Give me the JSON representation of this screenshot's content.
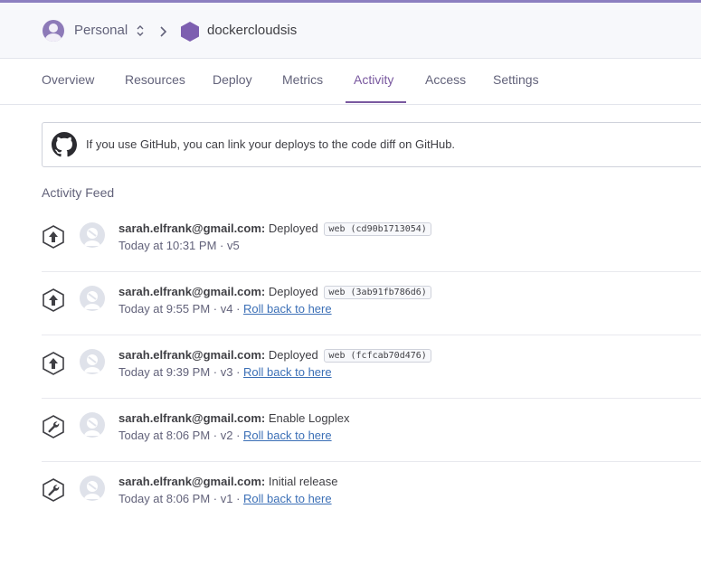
{
  "header": {
    "account": "Personal",
    "app_name": "dockercloudsis"
  },
  "tabs": [
    {
      "label": "Overview",
      "active": false
    },
    {
      "label": "Resources",
      "active": false
    },
    {
      "label": "Deploy",
      "active": false
    },
    {
      "label": "Metrics",
      "active": false
    },
    {
      "label": "Activity",
      "active": true
    },
    {
      "label": "Access",
      "active": false
    },
    {
      "label": "Settings",
      "active": false
    }
  ],
  "banner": {
    "text": "If you use GitHub, you can link your deploys to the code diff on GitHub.",
    "icon": "github-icon"
  },
  "feed": {
    "title": "Activity Feed",
    "items": [
      {
        "icon": "deploy-icon",
        "user": "sarah.elfrank@gmail.com:",
        "action": "Deployed",
        "code": "web (cd90b1713054)",
        "time": "Today at 10:31 PM",
        "version": "v5",
        "rollback": ""
      },
      {
        "icon": "deploy-icon",
        "user": "sarah.elfrank@gmail.com:",
        "action": "Deployed",
        "code": "web (3ab91fb786d6)",
        "time": "Today at 9:55 PM",
        "version": "v4",
        "rollback": "Roll back to here"
      },
      {
        "icon": "deploy-icon",
        "user": "sarah.elfrank@gmail.com:",
        "action": "Deployed",
        "code": "web (fcfcab70d476)",
        "time": "Today at 9:39 PM",
        "version": "v3",
        "rollback": "Roll back to here"
      },
      {
        "icon": "wrench-icon",
        "user": "sarah.elfrank@gmail.com:",
        "action": "Enable Logplex",
        "code": "",
        "time": "Today at 8:06 PM",
        "version": "v2",
        "rollback": "Roll back to here"
      },
      {
        "icon": "wrench-icon",
        "user": "sarah.elfrank@gmail.com:",
        "action": "Initial release",
        "code": "",
        "time": "Today at 8:06 PM",
        "version": "v1",
        "rollback": "Roll back to here"
      }
    ]
  },
  "colors": {
    "accent": "#79589f",
    "link": "#3b6fb6",
    "top_bar": "#8c7fc0"
  }
}
